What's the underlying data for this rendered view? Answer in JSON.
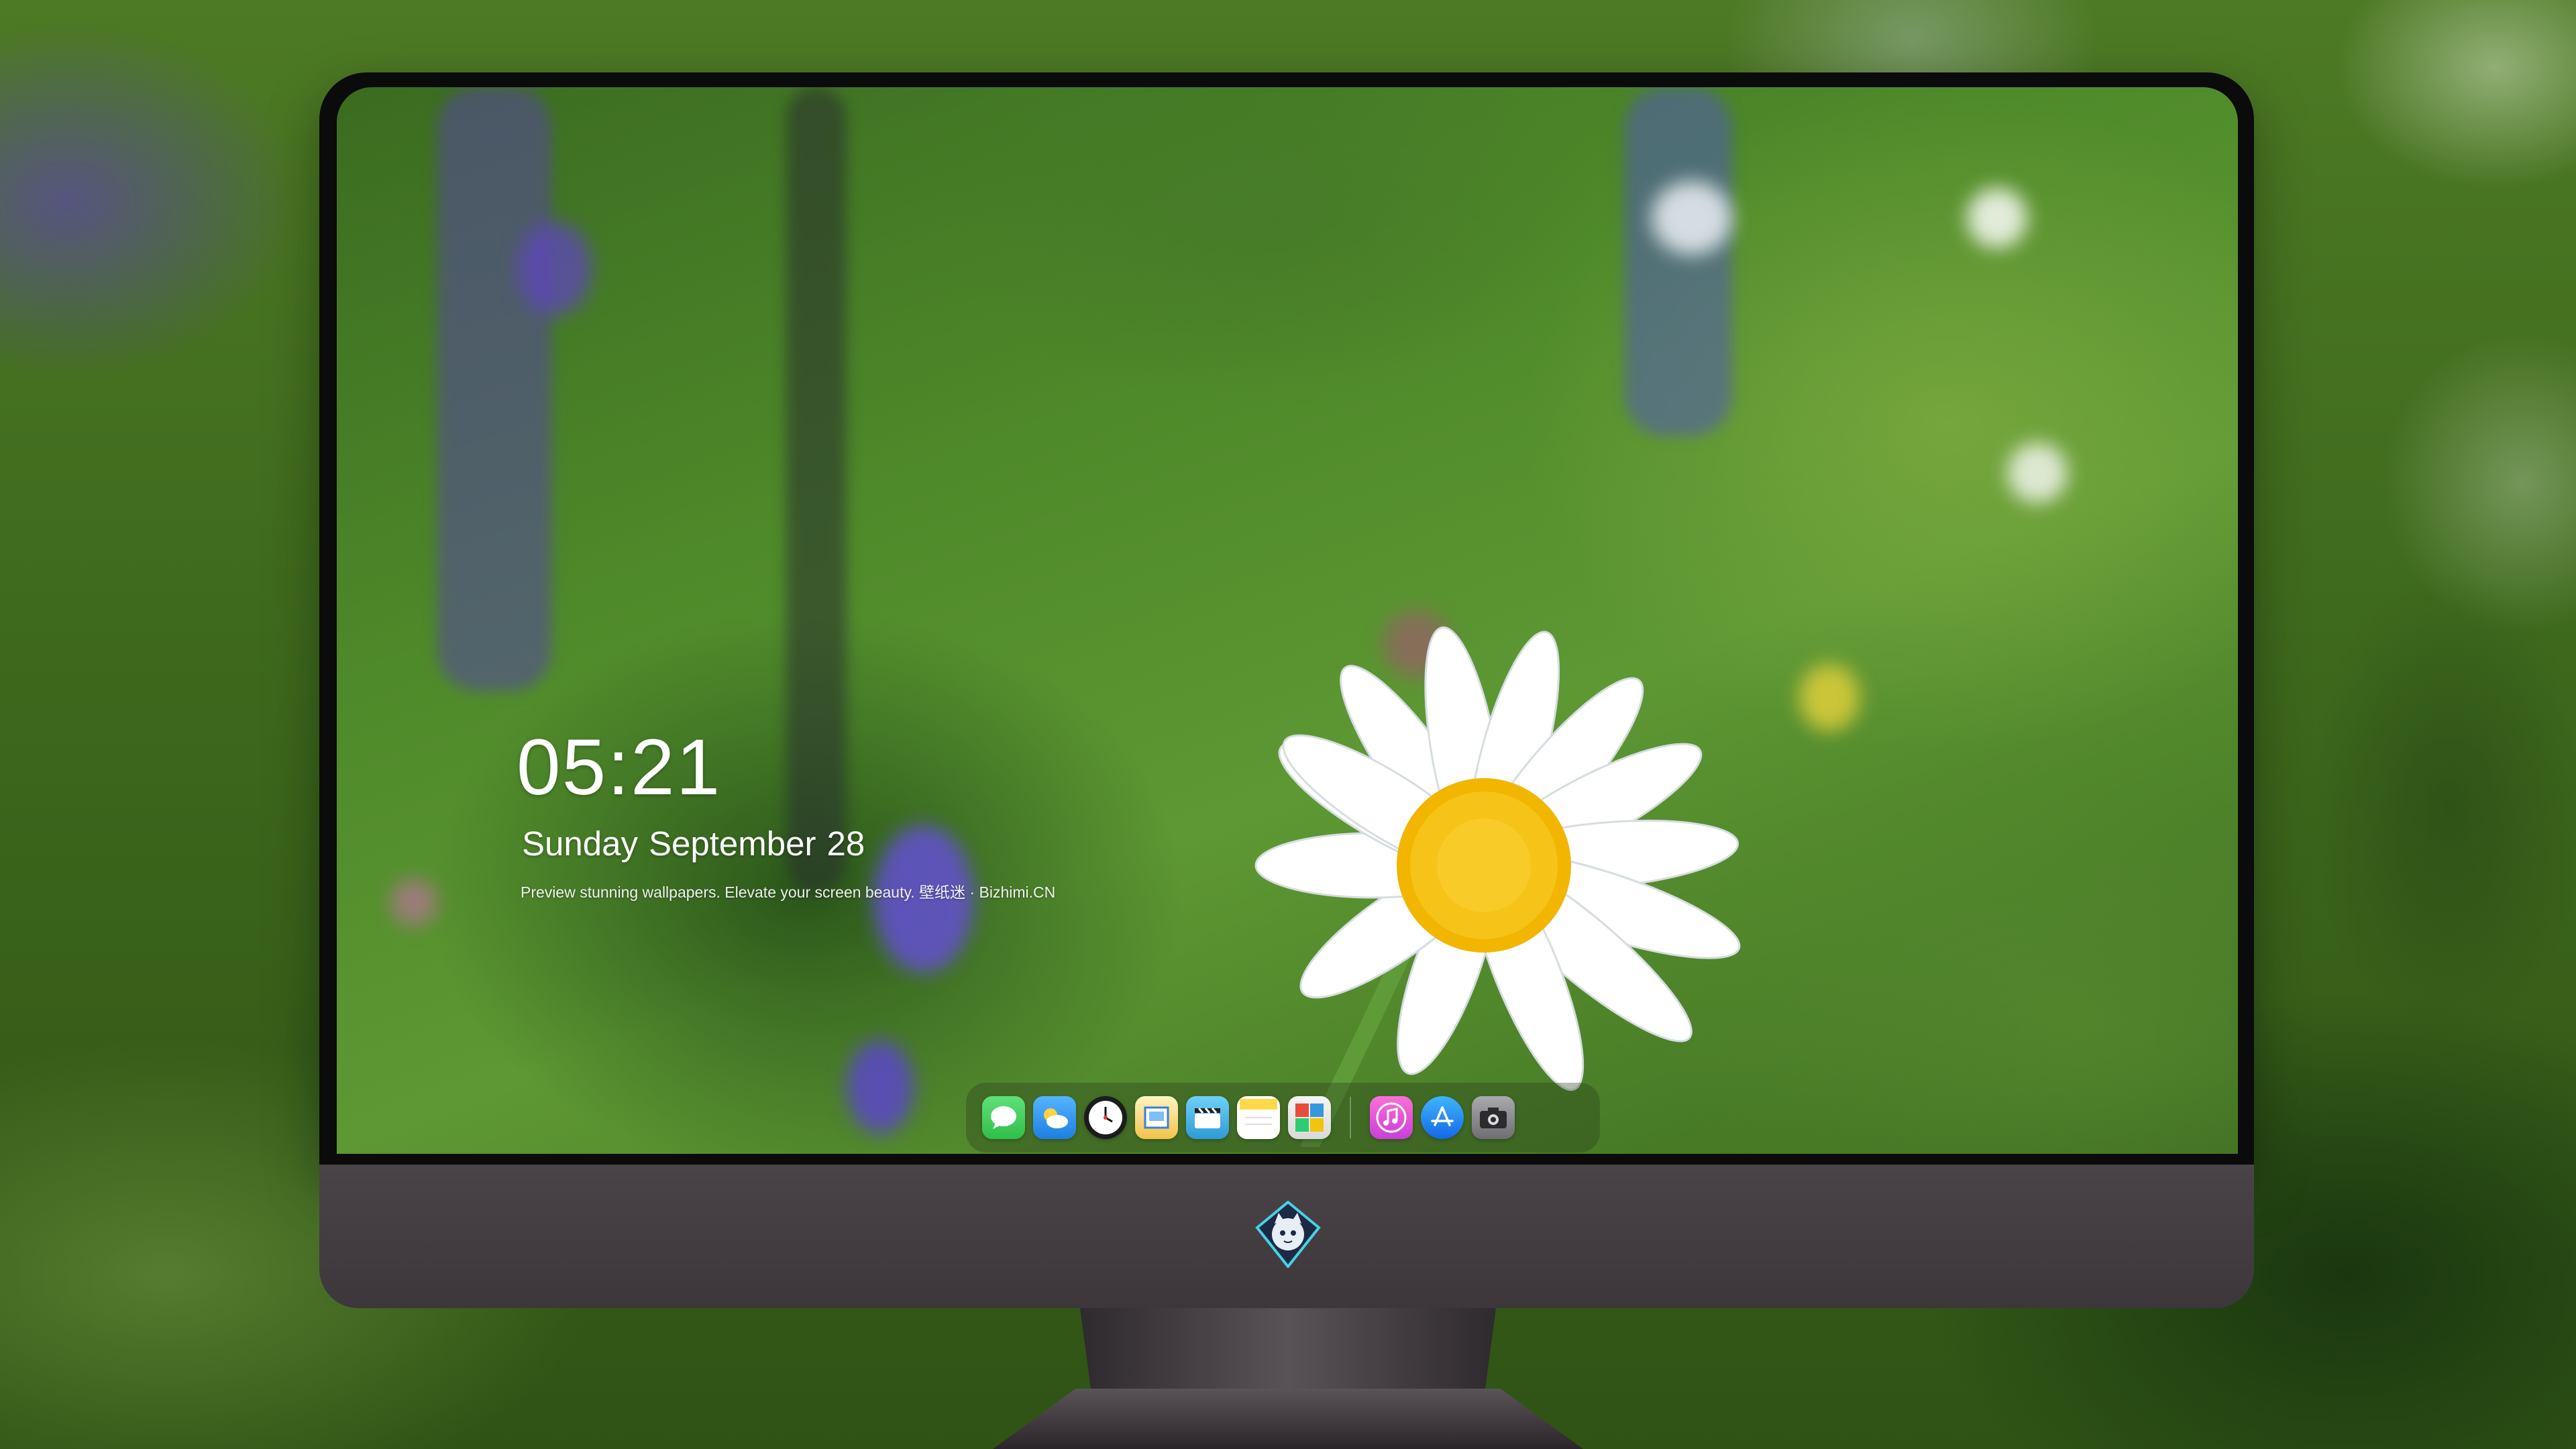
{
  "lockscreen": {
    "time": "05:21",
    "date_weekday": "Sunday",
    "date_month": "September",
    "date_day": "28",
    "tagline": "Preview stunning wallpapers. Elevate your screen beauty. 壁纸迷 · Bizhimi.CN"
  },
  "dock": {
    "apps": [
      {
        "name": "Messages",
        "icon": "messages-icon",
        "color": "#34c759"
      },
      {
        "name": "Weather",
        "icon": "weather-icon",
        "color": "#3a9bf0"
      },
      {
        "name": "Clock",
        "icon": "clock-icon",
        "color": "#1c1c1e"
      },
      {
        "name": "Preview",
        "icon": "preview-icon",
        "color": "#f1c24a"
      },
      {
        "name": "Clips",
        "icon": "clips-icon",
        "color": "#4bb7e8"
      },
      {
        "name": "Notes",
        "icon": "notes-icon",
        "color": "#ffd94a"
      },
      {
        "name": "Photo Booth",
        "icon": "photo-booth-icon",
        "color": "#e74c3c"
      },
      {
        "name": "iTunes",
        "icon": "itunes-icon",
        "color": "#e64ac8"
      },
      {
        "name": "App Store",
        "icon": "app-store-icon",
        "color": "#1f8ef1"
      },
      {
        "name": "Screenshot",
        "icon": "camera-icon",
        "color": "#8e8e93"
      }
    ]
  },
  "monitor": {
    "chin_logo": "bizhimi-mascot-logo",
    "colors": {
      "frame": "#0b0b0c",
      "chin": "#433d41"
    }
  }
}
